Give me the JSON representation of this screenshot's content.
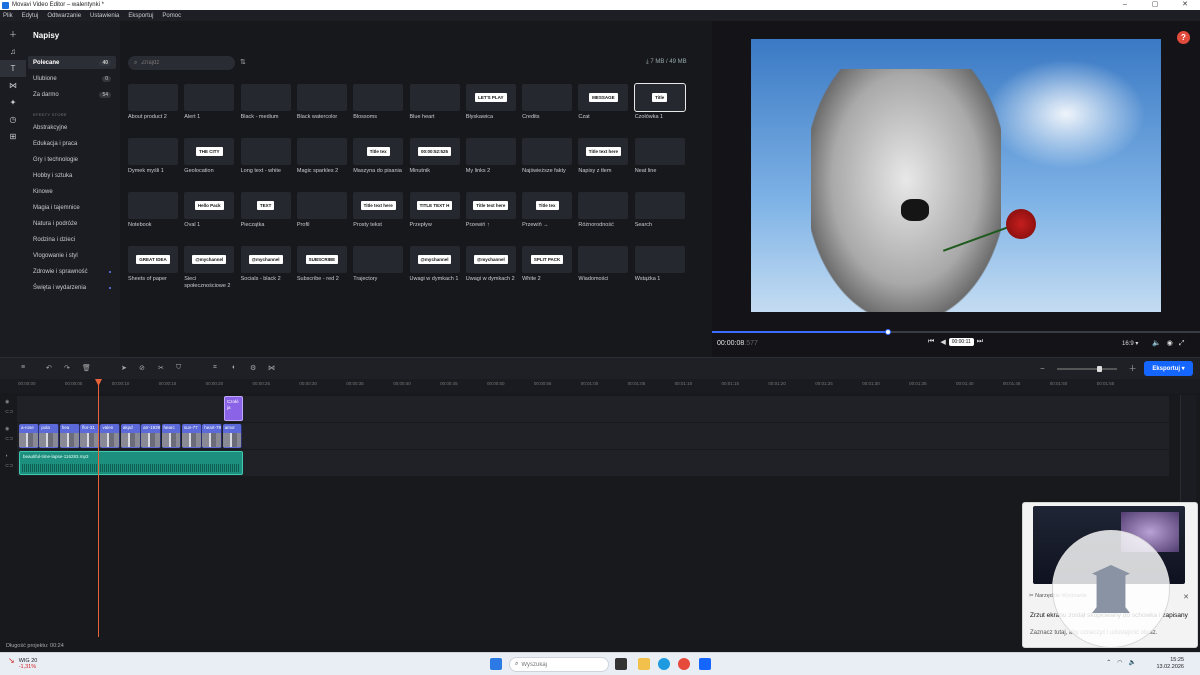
{
  "window": {
    "title": "Movavi Video Editor – walentynki *"
  },
  "menu": [
    "Plik",
    "Edytuj",
    "Odtwarzanie",
    "Ustawienia",
    "Eksportuj",
    "Pomoc"
  ],
  "panel": {
    "title": "Napisy",
    "search_placeholder": "Znajdź",
    "storage": "7 MB / 49 MB",
    "categories": [
      {
        "label": "Polecane",
        "count": "40",
        "active": true
      },
      {
        "label": "Ulubione",
        "count": "0"
      },
      {
        "label": "Za darmo",
        "count": "54"
      }
    ],
    "section_label": "EFEKTY STORE",
    "store_categories": [
      {
        "label": "Abstrakcyjne"
      },
      {
        "label": "Edukacja i praca"
      },
      {
        "label": "Gry i technologie"
      },
      {
        "label": "Hobby i sztuka"
      },
      {
        "label": "Kinowe"
      },
      {
        "label": "Magia i tajemnice"
      },
      {
        "label": "Natura i podróże"
      },
      {
        "label": "Rodzina i dzieci"
      },
      {
        "label": "Vlogowanie i styl"
      },
      {
        "label": "Zdrowie i sprawność",
        "dot": true
      },
      {
        "label": "Święta i wydarzenia",
        "dot": true
      }
    ]
  },
  "titles": [
    {
      "label": "About product 2",
      "thumb": ""
    },
    {
      "label": "Alert 1",
      "thumb": ""
    },
    {
      "label": "Black - medium",
      "thumb": ""
    },
    {
      "label": "Black watercolor",
      "thumb": ""
    },
    {
      "label": "Blossoms",
      "thumb": ""
    },
    {
      "label": "Blue heart",
      "thumb": ""
    },
    {
      "label": "Błyskawica",
      "thumb": "LET'S PLAY"
    },
    {
      "label": "Credits",
      "thumb": ""
    },
    {
      "label": "Czat",
      "thumb": "MESSAGE"
    },
    {
      "label": "Czołówka 1",
      "thumb": "Title"
    },
    {
      "label": "Dymek myśli 1",
      "thumb": ""
    },
    {
      "label": "Geolocation",
      "thumb": "THE CITY"
    },
    {
      "label": "Long text - white",
      "thumb": ""
    },
    {
      "label": "Magic sparkles 2",
      "thumb": ""
    },
    {
      "label": "Maszyna do pisania",
      "thumb": "Title tex"
    },
    {
      "label": "Minutnik",
      "thumb": "00:00:52:525"
    },
    {
      "label": "My links 2",
      "thumb": ""
    },
    {
      "label": "Najświeższe fakty",
      "thumb": ""
    },
    {
      "label": "Napisy z tłem",
      "thumb": "Title text here"
    },
    {
      "label": "Neat line",
      "thumb": ""
    },
    {
      "label": "Notebook",
      "thumb": ""
    },
    {
      "label": "Oval 1",
      "thumb": "Hello Pack"
    },
    {
      "label": "Pieczątka",
      "thumb": "TEXT"
    },
    {
      "label": "Profil",
      "thumb": ""
    },
    {
      "label": "Prosty tekst",
      "thumb": "Title text here"
    },
    {
      "label": "Przepływ",
      "thumb": "TITLE TEXT H"
    },
    {
      "label": "Przewiń ↑",
      "thumb": "Title text here"
    },
    {
      "label": "Przewiń →",
      "thumb": "Title tex"
    },
    {
      "label": "Różnorodność",
      "thumb": ""
    },
    {
      "label": "Search",
      "thumb": ""
    },
    {
      "label": "Sheets of paper",
      "thumb": "GREAT IDEA"
    },
    {
      "label": "Sieci społecznościowe 2",
      "thumb": "@mychannel"
    },
    {
      "label": "Socials - black 2",
      "thumb": "@mychannel"
    },
    {
      "label": "Subscribe - red 2",
      "thumb": "SUBSCRIBE"
    },
    {
      "label": "Trajectory",
      "thumb": ""
    },
    {
      "label": "Uwagi w dymkach 1",
      "thumb": "@mychannel"
    },
    {
      "label": "Uwagi w dymkach 2",
      "thumb": "@mychannel"
    },
    {
      "label": "White 2",
      "thumb": "SPLIT PACK"
    },
    {
      "label": "Wiadomości",
      "thumb": ""
    },
    {
      "label": "Wstążka 1",
      "thumb": ""
    }
  ],
  "player": {
    "time_main": "00:00:08",
    "time_ms": ".577",
    "tooltip": "00:00:11",
    "ratio": "16:9",
    "progress_fraction": 0.36
  },
  "timeline": {
    "export_label": "Eksportuj",
    "ticks": [
      "00:00:00",
      "00:00:05",
      "00:00:10",
      "00:00:15",
      "00:00:20",
      "00:00:25",
      "00:00:30",
      "00:00:35",
      "00:00:40",
      "00:00:45",
      "00:00:50",
      "00:00:55",
      "00:01:00",
      "00:01:05",
      "00:01:10",
      "00:01:15",
      "00:01:20",
      "00:01:25",
      "00:01:30",
      "00:01:35",
      "00:01:40",
      "00:01:45",
      "00:01:50",
      "00:01:55"
    ],
    "title_clip": "Czołó ja",
    "video_clips": [
      "a-rose",
      "pola",
      "hea",
      "flor-31",
      "valen",
      "akpd",
      "arr-1939",
      "hearc",
      "sun-77",
      "heart-795",
      "amor"
    ],
    "audio_clip": "beautiful-time-lapse-116283.mp3",
    "project_length": "Długość projektu: 00:24"
  },
  "taskbar": {
    "stock_name": "WIG 20",
    "stock_change": "-1,31%",
    "search_placeholder": "Wyszukaj",
    "time": "15:25",
    "date": "13.02.2026"
  },
  "toast": {
    "app": "Narzędzie Wycinanie",
    "message": "Zrzut ekranu został skopiowany do schowka i zapisany",
    "sub": "Zaznacz tutaj, aby oznaczyć i udostępnić obraz."
  },
  "colors": {
    "accent": "#1565ff",
    "playhead": "#e8623a",
    "title_clip": "#8a63e6",
    "video_clip": "#5b6ad8",
    "audio_clip": "#1c8f7e"
  }
}
